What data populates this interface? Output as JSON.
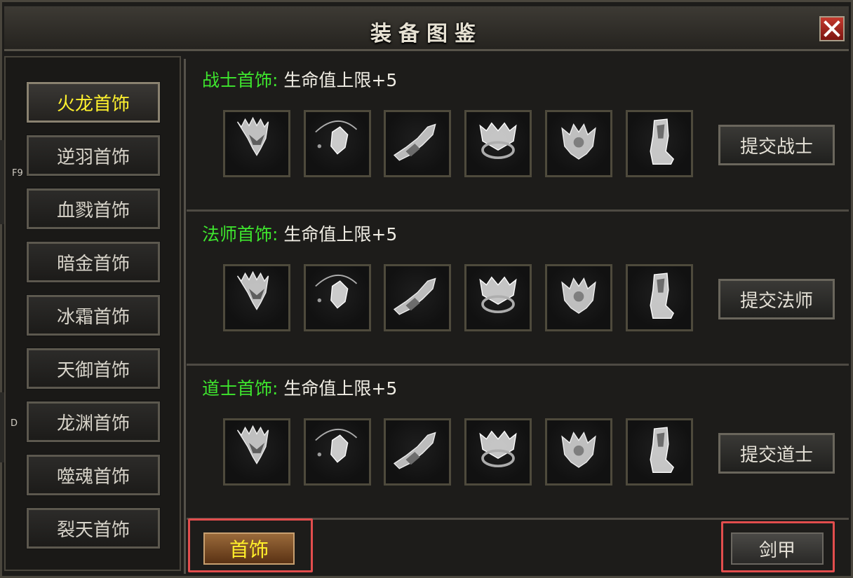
{
  "window": {
    "title": "装备图鉴"
  },
  "sidebar": {
    "items": [
      {
        "label": "火龙首饰",
        "active": true
      },
      {
        "label": "逆羽首饰",
        "active": false
      },
      {
        "label": "血戮首饰",
        "active": false
      },
      {
        "label": "暗金首饰",
        "active": false
      },
      {
        "label": "冰霜首饰",
        "active": false
      },
      {
        "label": "天御首饰",
        "active": false
      },
      {
        "label": "龙渊首饰",
        "active": false
      },
      {
        "label": "噬魂首饰",
        "active": false
      },
      {
        "label": "裂天首饰",
        "active": false
      }
    ],
    "hotkeys": [
      "F9",
      "D"
    ]
  },
  "sections": [
    {
      "class_label": "战士首饰:",
      "bonus": "生命值上限+5",
      "submit_label": "提交战士",
      "items": [
        "helmet-icon",
        "necklace-icon",
        "bracelet-icon",
        "ring-icon",
        "belt-icon",
        "boots-icon"
      ]
    },
    {
      "class_label": "法师首饰:",
      "bonus": "生命值上限+5",
      "submit_label": "提交法师",
      "items": [
        "helmet-icon",
        "necklace-icon",
        "bracelet-icon",
        "ring-icon",
        "belt-icon",
        "boots-icon"
      ]
    },
    {
      "class_label": "道士首饰:",
      "bonus": "生命值上限+5",
      "submit_label": "提交道士",
      "items": [
        "helmet-icon",
        "necklace-icon",
        "bracelet-icon",
        "ring-icon",
        "belt-icon",
        "boots-icon"
      ]
    }
  ],
  "tabs": [
    {
      "label": "首饰",
      "active": true
    },
    {
      "label": "剑甲",
      "active": false
    }
  ],
  "colors": {
    "class_label": "#3ee62e",
    "active_text": "#fff22e",
    "highlight": "#e24d4d"
  }
}
